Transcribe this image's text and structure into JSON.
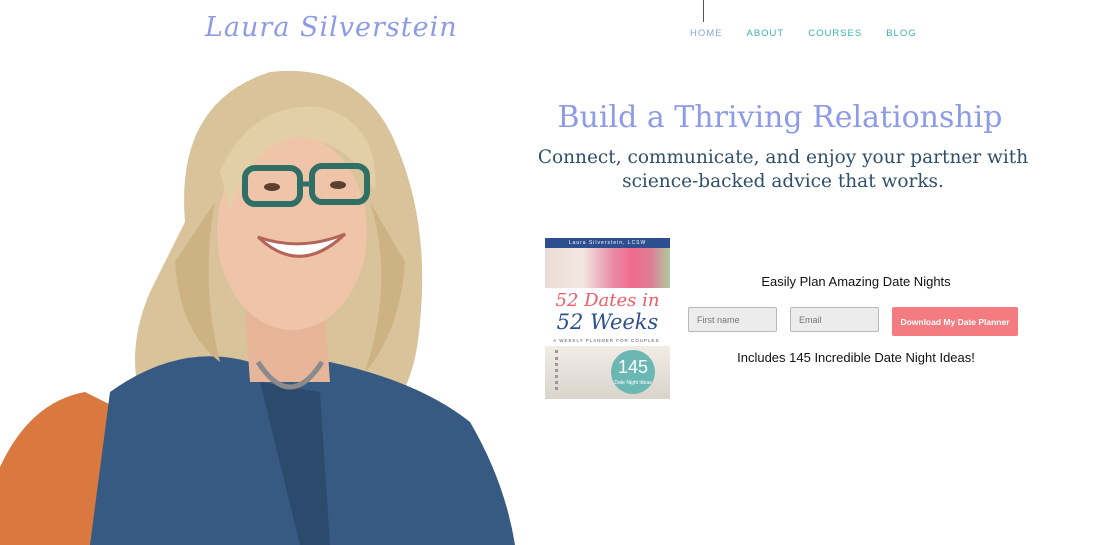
{
  "brand": {
    "logo_text": "Laura Silverstein",
    "logo_color": "#8e9be6"
  },
  "nav": {
    "items": [
      {
        "label": "HOME"
      },
      {
        "label": "ABOUT"
      },
      {
        "label": "COURSES"
      },
      {
        "label": "BLOG"
      }
    ],
    "accent_color": "#3bb3b1"
  },
  "hero": {
    "headline": "Build a Thriving Relationship",
    "subheadline": "Connect, communicate, and enjoy your partner with science-backed advice that works."
  },
  "planner_cover": {
    "author_band": "Laura Silverstein, LCSW",
    "title_line1": "52 Dates in",
    "title_line2": "52 Weeks",
    "tagline": "A WEEKLY PLANNER FOR COUPLES.",
    "badge_number": "145",
    "badge_text": "Date Night Ideas"
  },
  "signup": {
    "title": "Easily Plan Amazing Date Nights",
    "first_name_placeholder": "First name",
    "email_placeholder": "Email",
    "button_label": "Download My Date Planner",
    "button_color": "#f47c80",
    "note": "Includes 145 Incredible Date Night Ideas!"
  }
}
